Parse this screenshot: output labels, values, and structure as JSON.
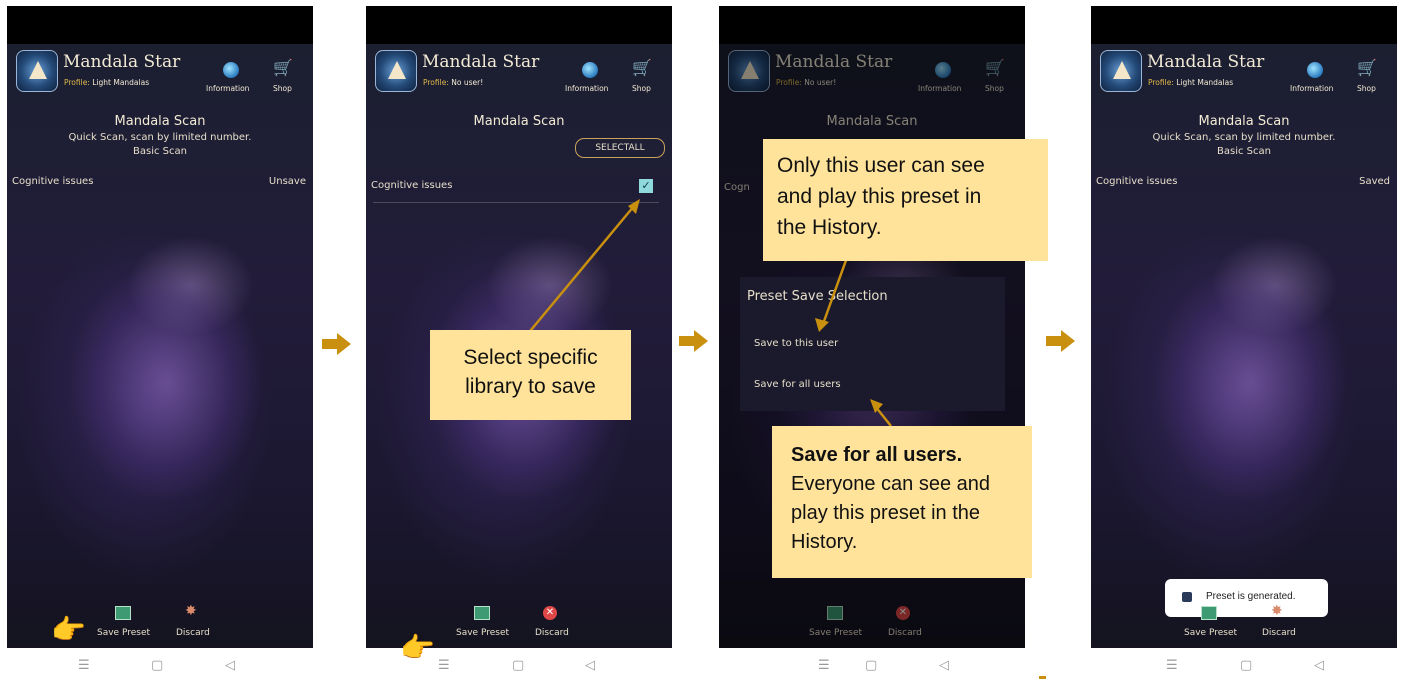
{
  "colors": {
    "arrow": "#c9900f",
    "callout_bg": "#ffe39a",
    "title_text": "#f3ead5",
    "profile_label": "#e0b84a"
  },
  "app": {
    "title": "Mandala Star",
    "profile_prefix": "Profile:",
    "info_label": "Information",
    "shop_label": "Shop",
    "scan_title": "Mandala Scan",
    "quick_scan": "Quick Scan, scan by limited number.",
    "basic_scan": "Basic Scan",
    "cognitive": "Cognitive issues",
    "save_preset": "Save Preset",
    "discard": "Discard",
    "icons": {
      "logo": "mandala-star-logo",
      "info": "globe-icon",
      "shop": "cart-icon",
      "save": "save-box-icon",
      "discard_broom": "broom-icon",
      "discard_x": "red-x-icon"
    }
  },
  "nav": {
    "menu": "☰",
    "home": "▢",
    "back": "◁"
  },
  "screens": [
    {
      "profile_name": "Light Mandalas",
      "status": "Unsave"
    },
    {
      "profile_name": "No user!",
      "select_all": "SELECTALL",
      "callout": [
        "Select specific",
        "library to save"
      ]
    },
    {
      "profile_name": "No user!",
      "row_label_partial": "Cogn",
      "dialog": {
        "title": "Preset Save Selection",
        "option1": "Save to this user",
        "option2": "Save for all users"
      },
      "callout_top": [
        "Only this user can see",
        "and play this preset in",
        "the History."
      ],
      "callout_bottom": {
        "bold": "Save for all users.",
        "lines": [
          "Everyone can see and",
          "play this preset in the",
          "History."
        ]
      }
    },
    {
      "profile_name": "Light Mandalas",
      "status": "Saved",
      "toast": "Preset is generated."
    }
  ]
}
